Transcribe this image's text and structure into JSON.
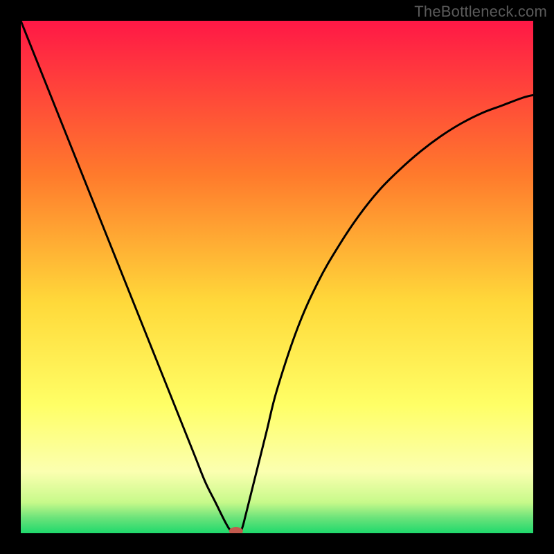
{
  "watermark": "TheBottleneck.com",
  "chart_data": {
    "type": "line",
    "title": "",
    "xlabel": "",
    "ylabel": "",
    "xlim": [
      0,
      100
    ],
    "ylim": [
      0,
      100
    ],
    "grid": false,
    "legend": false,
    "background": {
      "type": "vertical-gradient",
      "stops": [
        {
          "pct": 0,
          "color": "#ff1846"
        },
        {
          "pct": 30,
          "color": "#ff7a2c"
        },
        {
          "pct": 55,
          "color": "#ffd93a"
        },
        {
          "pct": 75,
          "color": "#ffff66"
        },
        {
          "pct": 88,
          "color": "#fbffb0"
        },
        {
          "pct": 94,
          "color": "#c7f98a"
        },
        {
          "pct": 97,
          "color": "#6be37a"
        },
        {
          "pct": 100,
          "color": "#1ed96c"
        }
      ]
    },
    "curve": {
      "description": "V-shaped bottleneck curve: steep drop from top-left to minimum near x≈42, then rising asymptotically toward top-right",
      "x": [
        0,
        2,
        4,
        6,
        8,
        10,
        12,
        14,
        16,
        18,
        20,
        22,
        24,
        26,
        28,
        30,
        32,
        34,
        36,
        38,
        40,
        41,
        42,
        43,
        44,
        46,
        48,
        50,
        54,
        58,
        62,
        66,
        70,
        74,
        78,
        82,
        86,
        90,
        94,
        98,
        100
      ],
      "y": [
        100,
        95,
        90,
        85,
        80,
        75,
        70,
        65,
        60,
        55,
        50,
        45,
        40,
        35,
        30,
        25,
        20,
        15,
        10,
        6,
        2,
        0.5,
        0,
        0.5,
        4,
        12,
        20,
        28,
        40,
        49,
        56,
        62,
        67,
        71,
        74.5,
        77.5,
        80,
        82,
        83.5,
        85,
        85.5
      ]
    },
    "minimum_marker": {
      "x": 42,
      "y": 0,
      "color": "#c25a4e",
      "rx": 10,
      "ry": 6
    }
  }
}
